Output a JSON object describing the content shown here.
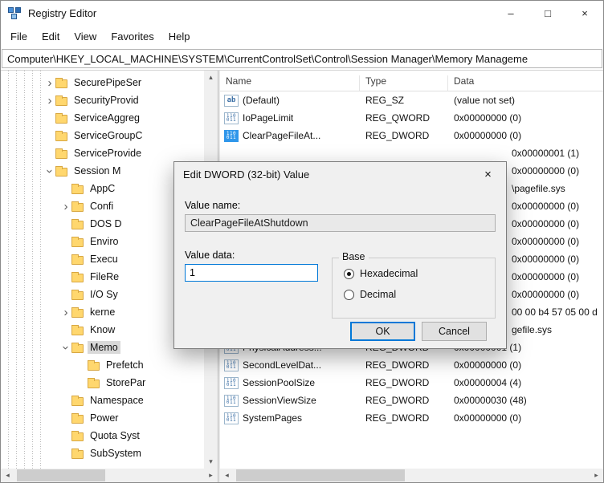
{
  "window": {
    "title": "Registry Editor",
    "minimize": "–",
    "maximize": "□",
    "close": "×"
  },
  "menu": [
    "File",
    "Edit",
    "View",
    "Favorites",
    "Help"
  ],
  "address": "Computer\\HKEY_LOCAL_MACHINE\\SYSTEM\\CurrentControlSet\\Control\\Session Manager\\Memory Manageme",
  "tree": [
    {
      "label": "SecurePipeSer",
      "level": 0,
      "state": "collapsed",
      "selected": false
    },
    {
      "label": "SecurityProvid",
      "level": 0,
      "state": "collapsed",
      "selected": false
    },
    {
      "label": "ServiceAggreg",
      "level": 0,
      "state": "none",
      "selected": false
    },
    {
      "label": "ServiceGroupC",
      "level": 0,
      "state": "none",
      "selected": false
    },
    {
      "label": "ServiceProvide",
      "level": 0,
      "state": "none",
      "selected": false
    },
    {
      "label": "Session M",
      "level": 0,
      "state": "expanded",
      "selected": false
    },
    {
      "label": "AppC",
      "level": 1,
      "state": "none",
      "selected": false
    },
    {
      "label": "Confi",
      "level": 1,
      "state": "collapsed",
      "selected": false
    },
    {
      "label": "DOS D",
      "level": 1,
      "state": "none",
      "selected": false
    },
    {
      "label": "Enviro",
      "level": 1,
      "state": "none",
      "selected": false
    },
    {
      "label": "Execu",
      "level": 1,
      "state": "none",
      "selected": false
    },
    {
      "label": "FileRe",
      "level": 1,
      "state": "none",
      "selected": false
    },
    {
      "label": "I/O Sy",
      "level": 1,
      "state": "none",
      "selected": false
    },
    {
      "label": "kerne",
      "level": 1,
      "state": "collapsed",
      "selected": false
    },
    {
      "label": "Know",
      "level": 1,
      "state": "none",
      "selected": false
    },
    {
      "label": "Memo",
      "level": 1,
      "state": "expanded",
      "selected": true
    },
    {
      "label": "Prefetch",
      "level": 2,
      "state": "none",
      "selected": false
    },
    {
      "label": "StorePar",
      "level": 2,
      "state": "none",
      "selected": false
    },
    {
      "label": "Namespace",
      "level": 1,
      "state": "none",
      "selected": false
    },
    {
      "label": "Power",
      "level": 1,
      "state": "none",
      "selected": false
    },
    {
      "label": "Quota Syst",
      "level": 1,
      "state": "none",
      "selected": false
    },
    {
      "label": "SubSystem",
      "level": 1,
      "state": "none",
      "selected": false
    }
  ],
  "list": {
    "columns": [
      "Name",
      "Type",
      "Data"
    ],
    "rows": [
      {
        "name": "(Default)",
        "type": "REG_SZ",
        "data": "(value not set)",
        "icon": "string",
        "selected": false,
        "partial": false
      },
      {
        "name": "IoPageLimit",
        "type": "REG_QWORD",
        "data": "0x00000000 (0)",
        "icon": "binary",
        "selected": false,
        "partial": false
      },
      {
        "name": "ClearPageFileAt...",
        "type": "REG_DWORD",
        "data": "0x00000000 (0)",
        "icon": "binary",
        "selected": true,
        "partial": false
      },
      {
        "name": "",
        "type": "",
        "data": "0x00000001 (1)",
        "icon": "none",
        "selected": false,
        "partial": true
      },
      {
        "name": "",
        "type": "",
        "data": "0x00000000 (0)",
        "icon": "none",
        "selected": false,
        "partial": true
      },
      {
        "name": "",
        "type": "",
        "data": "\\pagefile.sys",
        "icon": "none",
        "selected": false,
        "partial": true
      },
      {
        "name": "",
        "type": "",
        "data": "0x00000000 (0)",
        "icon": "none",
        "selected": false,
        "partial": true
      },
      {
        "name": "",
        "type": "",
        "data": "0x00000000 (0)",
        "icon": "none",
        "selected": false,
        "partial": true
      },
      {
        "name": "",
        "type": "",
        "data": "0x00000000 (0)",
        "icon": "none",
        "selected": false,
        "partial": true
      },
      {
        "name": "",
        "type": "",
        "data": "0x00000000 (0)",
        "icon": "none",
        "selected": false,
        "partial": true
      },
      {
        "name": "",
        "type": "",
        "data": "0x00000000 (0)",
        "icon": "none",
        "selected": false,
        "partial": true
      },
      {
        "name": "",
        "type": "",
        "data": "0x00000000 (0)",
        "icon": "none",
        "selected": false,
        "partial": true
      },
      {
        "name": "",
        "type": "",
        "data": "00 00 b4 57 05 00 d",
        "icon": "none",
        "selected": false,
        "partial": true
      },
      {
        "name": "",
        "type": "",
        "data": "gefile.sys",
        "icon": "none",
        "selected": false,
        "partial": true
      },
      {
        "name": "PhysicalAddress...",
        "type": "REG_DWORD",
        "data": "0x00000001 (1)",
        "icon": "binary",
        "selected": false,
        "partial": false
      },
      {
        "name": "SecondLevelDat...",
        "type": "REG_DWORD",
        "data": "0x00000000 (0)",
        "icon": "binary",
        "selected": false,
        "partial": false
      },
      {
        "name": "SessionPoolSize",
        "type": "REG_DWORD",
        "data": "0x00000004 (4)",
        "icon": "binary",
        "selected": false,
        "partial": false
      },
      {
        "name": "SessionViewSize",
        "type": "REG_DWORD",
        "data": "0x00000030 (48)",
        "icon": "binary",
        "selected": false,
        "partial": false
      },
      {
        "name": "SystemPages",
        "type": "REG_DWORD",
        "data": "0x00000000 (0)",
        "icon": "binary",
        "selected": false,
        "partial": false
      }
    ]
  },
  "dialog": {
    "title": "Edit DWORD (32-bit) Value",
    "close": "×",
    "value_name_label": "Value name:",
    "value_name": "ClearPageFileAtShutdown",
    "value_data_label": "Value data:",
    "value_data": "1",
    "base_label": "Base",
    "options": [
      "Hexadecimal",
      "Decimal"
    ],
    "selected_option": "Hexadecimal",
    "ok_label": "OK",
    "cancel_label": "Cancel"
  },
  "scrollbars": {
    "up": "▴",
    "down": "▾",
    "left": "◂",
    "right": "▸"
  }
}
